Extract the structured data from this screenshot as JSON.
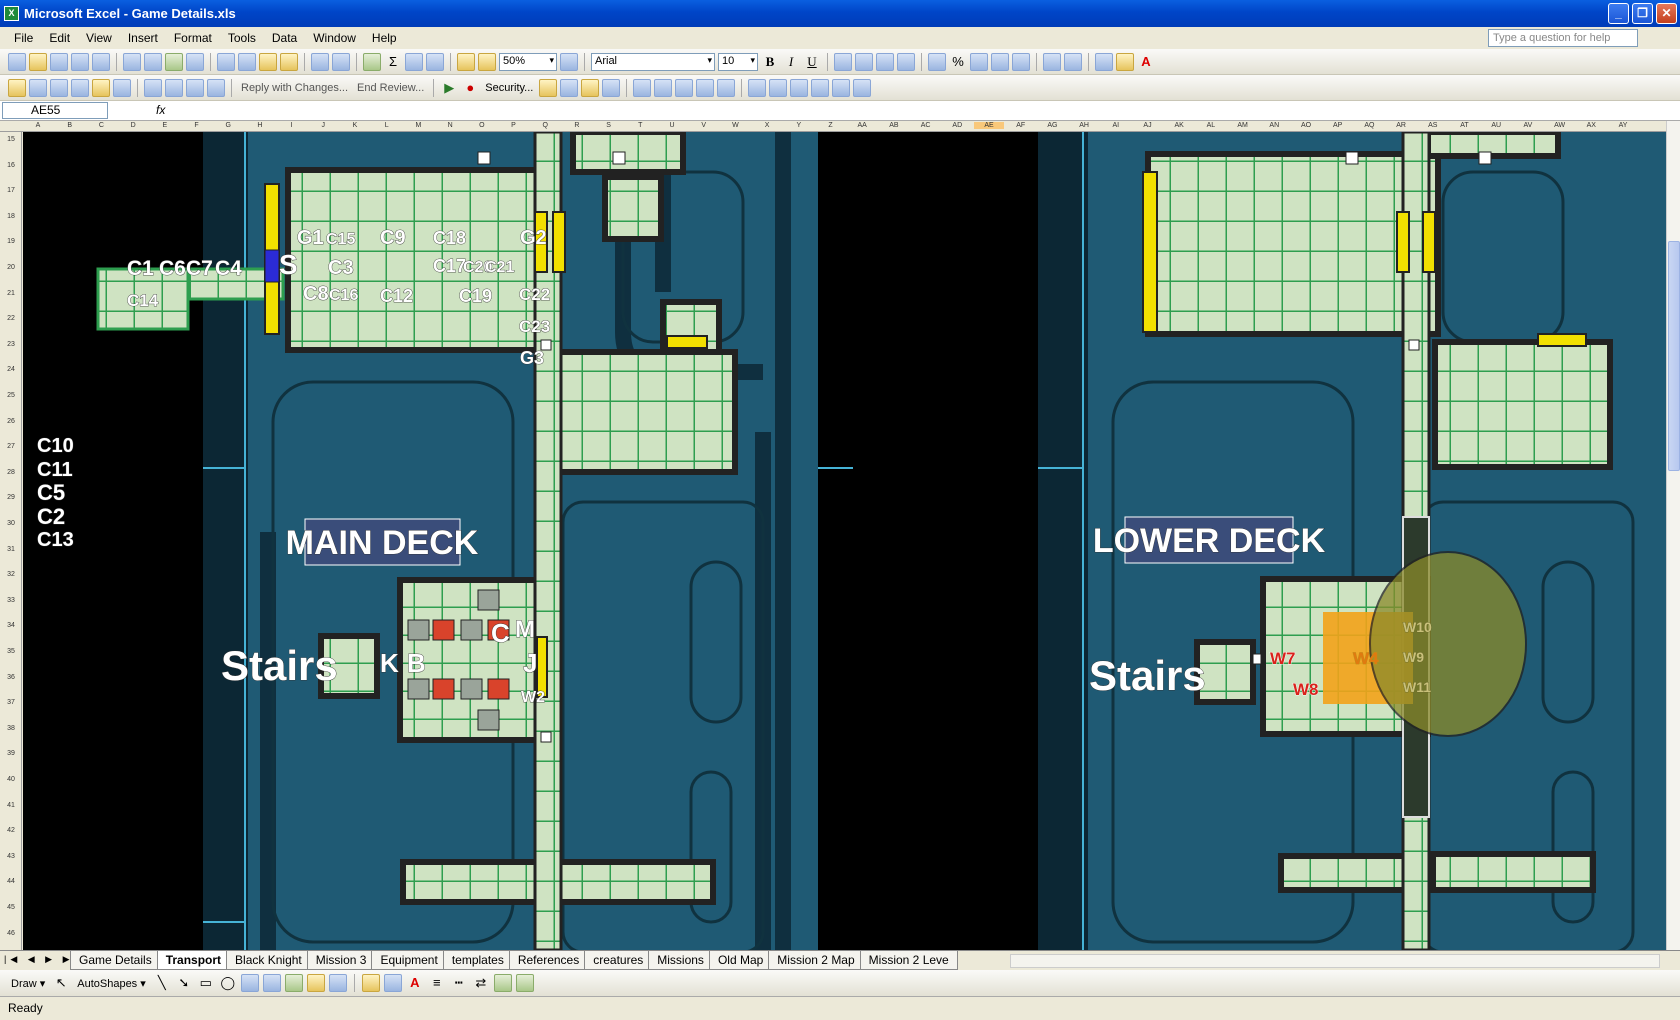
{
  "window": {
    "title": "Microsoft Excel - Game Details.xls",
    "buttons": [
      "_",
      "❐",
      "✕"
    ]
  },
  "menu": [
    "File",
    "Edit",
    "View",
    "Insert",
    "Format",
    "Tools",
    "Data",
    "Window",
    "Help"
  ],
  "ask_placeholder": "Type a question for help",
  "toolbar1": {
    "zoom": "50%",
    "font": "Arial",
    "font_size": "10",
    "bold": "B",
    "italic": "I",
    "underline": "U",
    "percent": "%"
  },
  "toolbar2": {
    "reply": "Reply with Changes...",
    "end_review": "End Review...",
    "security": "Security..."
  },
  "formula": {
    "name_box": "AE55",
    "fx": "fx",
    "value": ""
  },
  "columns": [
    "A",
    "B",
    "C",
    "D",
    "E",
    "F",
    "G",
    "H",
    "I",
    "J",
    "K",
    "L",
    "M",
    "N",
    "O",
    "P",
    "Q",
    "R",
    "S",
    "T",
    "U",
    "V",
    "W",
    "X",
    "Y",
    "Z",
    "AA",
    "AB",
    "AC",
    "AD",
    "AE",
    "AF",
    "AG",
    "AH",
    "AI",
    "AJ",
    "AK",
    "AL",
    "AM",
    "AN",
    "AO",
    "AP",
    "AQ",
    "AR",
    "AS",
    "AT",
    "AU",
    "AV",
    "AW",
    "AX",
    "AY"
  ],
  "selected_column": "AE",
  "rows": [
    "15",
    "16",
    "17",
    "18",
    "19",
    "20",
    "21",
    "22",
    "23",
    "24",
    "25",
    "26",
    "27",
    "28",
    "29",
    "30",
    "31",
    "32",
    "33",
    "34",
    "35",
    "36",
    "37",
    "38",
    "39",
    "40",
    "41",
    "42",
    "43",
    "44",
    "45",
    "46"
  ],
  "sheet": {
    "side_list": [
      "C10",
      "C11",
      "C5",
      "C2",
      "C13"
    ],
    "main_deck": {
      "title": "MAIN DECK",
      "stairs": "Stairs",
      "labels": {
        "g1": "G1",
        "c15": "C15",
        "c9": "C9",
        "c18": "C18",
        "g2": "G2",
        "s": "S",
        "c3": "C3",
        "c17": "C17",
        "c20": "C20",
        "c21": "C21",
        "c8": "C8",
        "c16": "C16",
        "c12": "C12",
        "c19": "C19",
        "c22": "C22",
        "c23": "C23",
        "g3": "G3",
        "c1": "C1",
        "c6": "C6",
        "c7": "C7",
        "c4": "C4",
        "c14": "C14",
        "k": "K",
        "b": "B",
        "c": "C",
        "m": "M",
        "j": "J",
        "w2": "W2"
      }
    },
    "lower_deck": {
      "title": "LOWER DECK",
      "stairs": "Stairs",
      "labels": {
        "w7": "W7",
        "w8": "W8",
        "w4": "W4",
        "w10": "W10",
        "w9": "W9",
        "w11": "W11"
      }
    }
  },
  "sheet_tabs": [
    "Game Details",
    "Transport",
    "Black Knight",
    "Mission 3",
    "Equipment",
    "templates",
    "References",
    "creatures",
    "Missions",
    "Old Map",
    "Mission 2 Map",
    "Mission 2 Leve"
  ],
  "active_tab": "Transport",
  "drawbar": {
    "draw": "Draw ▾",
    "autoshapes": "AutoShapes ▾"
  },
  "status": "Ready",
  "colors": {
    "hull": "#1f5a74",
    "deck_green": "#2e9e4f",
    "floor": "#cfe3c2",
    "door_yellow": "#f2e000",
    "title_bg": "#3a4d7a",
    "hazard_red": "#d9432b",
    "circle": "#8a8a2a"
  }
}
